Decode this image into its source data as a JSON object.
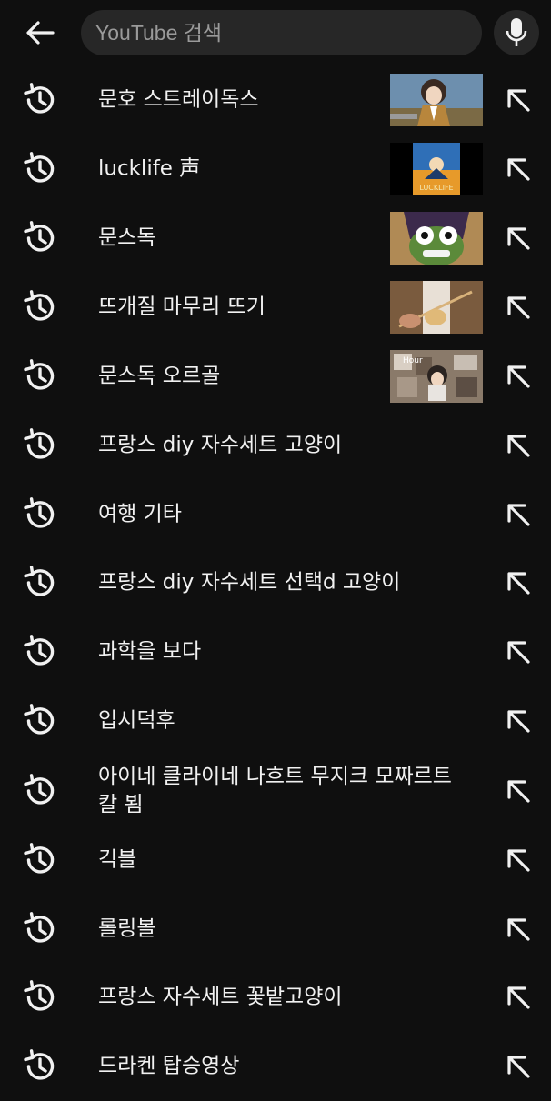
{
  "search": {
    "placeholder": "YouTube 검색",
    "value": ""
  },
  "items": [
    {
      "text": "문호 스트레이독스",
      "thumbnail": "anime-character-thumbnail"
    },
    {
      "text": "lucklife 声",
      "thumbnail": "album-cover-thumbnail",
      "thumb_text": "LUCKLIFE"
    },
    {
      "text": "문스독",
      "thumbnail": "anime-face-thumbnail"
    },
    {
      "text": "뜨개질 마무리 뜨기",
      "thumbnail": "knitting-thumbnail"
    },
    {
      "text": "문스독 오르골",
      "thumbnail": "collage-thumbnail",
      "thumb_text": "Hour"
    },
    {
      "text": "프랑스 diy 자수세트 고양이"
    },
    {
      "text": "여행 기타"
    },
    {
      "text": "프랑스 diy 자수세트 선택d 고양이"
    },
    {
      "text": "과학을 보다"
    },
    {
      "text": "입시덕후"
    },
    {
      "text": "아이네 클라이네 나흐트 무지크 모짜르트 칼 뵘"
    },
    {
      "text": "긱블"
    },
    {
      "text": "롤링볼"
    },
    {
      "text": "프랑스 자수세트 꽃밭고양이"
    },
    {
      "text": "드라켄 탑승영상"
    }
  ],
  "colors": {
    "background": "#0f0f0f",
    "searchbox": "#272727",
    "text": "#f1f1f1"
  }
}
